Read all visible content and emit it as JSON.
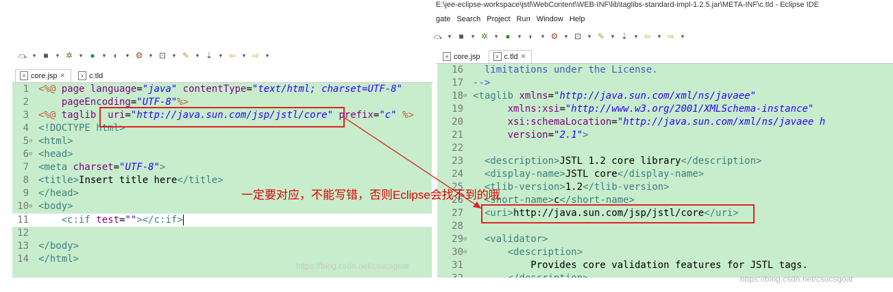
{
  "window": {
    "title_path": "E:\\jee-eclipse-workspace\\jstl\\WebContent\\WEB-INF\\lib\\taglibs-standard-impl-1.2.5.jar\\META-INF\\c.tld - Eclipse IDE",
    "menu": [
      "gate",
      "Search",
      "Project",
      "Run",
      "Window",
      "Help"
    ]
  },
  "left": {
    "tabs": [
      {
        "label": "core.jsp",
        "active": true
      },
      {
        "label": "c.tld",
        "active": false
      }
    ],
    "lines": [
      {
        "n": "1",
        "fold": "",
        "segs": [
          [
            "jsp",
            "<%@ "
          ],
          [
            "attr",
            "page "
          ],
          [
            "attr",
            "language"
          ],
          [
            "text",
            "="
          ],
          [
            "val",
            "\"java\""
          ],
          [
            "text",
            " "
          ],
          [
            "attr",
            "contentType"
          ],
          [
            "text",
            "="
          ],
          [
            "val",
            "\"text/html; charset=UTF-8\""
          ]
        ]
      },
      {
        "n": "2",
        "fold": "",
        "segs": [
          [
            "text",
            "    "
          ],
          [
            "attr",
            "pageEncoding"
          ],
          [
            "text",
            "="
          ],
          [
            "val",
            "\"UTF-8\""
          ],
          [
            "jsp",
            "%>"
          ]
        ]
      },
      {
        "n": "3",
        "fold": "",
        "segs": [
          [
            "jsp",
            "<%@ "
          ],
          [
            "attr",
            "taglib  "
          ],
          [
            "attr",
            "uri"
          ],
          [
            "text",
            "="
          ],
          [
            "val",
            "\"http://java.sun.com/jsp/jstl/core\""
          ],
          [
            "text",
            " "
          ],
          [
            "attr",
            "prefix"
          ],
          [
            "text",
            "="
          ],
          [
            "val",
            "\"c\""
          ],
          [
            "text",
            " "
          ],
          [
            "jsp",
            "%>"
          ]
        ]
      },
      {
        "n": "4",
        "fold": "",
        "segs": [
          [
            "tag",
            "<!DOCTYPE html>"
          ]
        ]
      },
      {
        "n": "5",
        "fold": "⊖",
        "segs": [
          [
            "tag",
            "<html>"
          ]
        ]
      },
      {
        "n": "6",
        "fold": "⊖",
        "segs": [
          [
            "tag",
            "<head>"
          ]
        ]
      },
      {
        "n": "7",
        "fold": "",
        "segs": [
          [
            "tag",
            "<meta "
          ],
          [
            "attr",
            "charset"
          ],
          [
            "text",
            "="
          ],
          [
            "val",
            "\"UTF-8\""
          ],
          [
            "tag",
            ">"
          ]
        ]
      },
      {
        "n": "8",
        "fold": "",
        "segs": [
          [
            "tag",
            "<title>"
          ],
          [
            "text",
            "Insert title here"
          ],
          [
            "tag",
            "</title>"
          ]
        ]
      },
      {
        "n": "9",
        "fold": "",
        "segs": [
          [
            "tag",
            "</head>"
          ]
        ]
      },
      {
        "n": "10",
        "fold": "⊖",
        "segs": [
          [
            "tag",
            "<body>"
          ]
        ]
      },
      {
        "n": "11",
        "fold": "",
        "segs": [
          [
            "text",
            "    "
          ],
          [
            "tag",
            "<c:if "
          ],
          [
            "attr",
            "test"
          ],
          [
            "text",
            "="
          ],
          [
            "val",
            "\"\""
          ],
          [
            "tag",
            "></c:if>"
          ]
        ]
      },
      {
        "n": "12",
        "fold": "",
        "segs": [
          [
            "text",
            ""
          ]
        ]
      },
      {
        "n": "13",
        "fold": "",
        "segs": [
          [
            "tag",
            "</body>"
          ]
        ]
      },
      {
        "n": "14",
        "fold": "",
        "segs": [
          [
            "tag",
            "</html>"
          ]
        ]
      }
    ],
    "watermark": "https://blog.csdn.net/csucsgoat"
  },
  "right": {
    "tabs": [
      {
        "label": "core.jsp",
        "active": false
      },
      {
        "label": "c.tld",
        "active": true
      }
    ],
    "lines": [
      {
        "n": "16",
        "fold": "",
        "segs": [
          [
            "cmt",
            "  limitations under the License."
          ]
        ]
      },
      {
        "n": "17",
        "fold": "",
        "segs": [
          [
            "cmt",
            "-->"
          ]
        ]
      },
      {
        "n": "18",
        "fold": "⊖",
        "segs": [
          [
            "tag",
            "<taglib "
          ],
          [
            "attr",
            "xmlns"
          ],
          [
            "text",
            "="
          ],
          [
            "val",
            "\"http://java.sun.com/xml/ns/javaee\""
          ]
        ]
      },
      {
        "n": "19",
        "fold": "",
        "segs": [
          [
            "text",
            "      "
          ],
          [
            "attr",
            "xmlns:xsi"
          ],
          [
            "text",
            "="
          ],
          [
            "val",
            "\"http://www.w3.org/2001/XMLSchema-instance\""
          ]
        ]
      },
      {
        "n": "20",
        "fold": "",
        "segs": [
          [
            "text",
            "      "
          ],
          [
            "attr",
            "xsi:schemaLocation"
          ],
          [
            "text",
            "="
          ],
          [
            "val",
            "\"http://java.sun.com/xml/ns/javaee h"
          ]
        ]
      },
      {
        "n": "21",
        "fold": "",
        "segs": [
          [
            "text",
            "      "
          ],
          [
            "attr",
            "version"
          ],
          [
            "text",
            "="
          ],
          [
            "val",
            "\"2.1\""
          ],
          [
            "tag",
            ">"
          ]
        ]
      },
      {
        "n": "22",
        "fold": "",
        "segs": [
          [
            "text",
            ""
          ]
        ]
      },
      {
        "n": "23",
        "fold": "",
        "segs": [
          [
            "text",
            "  "
          ],
          [
            "tag",
            "<description>"
          ],
          [
            "text",
            "JSTL 1.2 core library"
          ],
          [
            "tag",
            "</description>"
          ]
        ]
      },
      {
        "n": "24",
        "fold": "",
        "segs": [
          [
            "text",
            "  "
          ],
          [
            "tag",
            "<display-name>"
          ],
          [
            "text",
            "JSTL core"
          ],
          [
            "tag",
            "</display-name>"
          ]
        ]
      },
      {
        "n": "25",
        "fold": "",
        "segs": [
          [
            "text",
            "  "
          ],
          [
            "tag",
            "<tlib-version>"
          ],
          [
            "text",
            "1.2"
          ],
          [
            "tag",
            "</tlib-version>"
          ]
        ]
      },
      {
        "n": "26",
        "fold": "",
        "segs": [
          [
            "text",
            "  "
          ],
          [
            "tag",
            "<short-name>"
          ],
          [
            "text",
            "c"
          ],
          [
            "tag",
            "</short-name>"
          ]
        ]
      },
      {
        "n": "27",
        "fold": "",
        "segs": [
          [
            "text",
            "  "
          ],
          [
            "tag",
            "<uri>"
          ],
          [
            "text",
            "http://java.sun.com/jsp/jstl/core"
          ],
          [
            "tag",
            "</uri>"
          ]
        ]
      },
      {
        "n": "28",
        "fold": "",
        "segs": [
          [
            "text",
            ""
          ]
        ]
      },
      {
        "n": "29",
        "fold": "⊖",
        "segs": [
          [
            "text",
            "  "
          ],
          [
            "tag",
            "<validator>"
          ]
        ]
      },
      {
        "n": "30",
        "fold": "⊖",
        "segs": [
          [
            "text",
            "      "
          ],
          [
            "tag",
            "<description>"
          ]
        ]
      },
      {
        "n": "31",
        "fold": "",
        "segs": [
          [
            "text",
            "          Provides core validation features for JSTL tags."
          ]
        ]
      },
      {
        "n": "32",
        "fold": "",
        "segs": [
          [
            "text",
            "      "
          ],
          [
            "tag",
            "</description>"
          ]
        ]
      }
    ],
    "watermark": "https://blog.csdn.net/csucsgoat"
  },
  "annotation": {
    "text": "一定要对应，不能写错，否则Eclipse会找不到的哦",
    "color": "#e00000"
  },
  "colors": {
    "editor_bg": "#c7edcc",
    "tag": "#3f7f7f",
    "attr": "#7f007f",
    "value": "#2a00ff",
    "jsp": "#bf5f3f",
    "comment": "#3f5fbf",
    "highlight_box": "#e02020"
  },
  "toolbar_icons": [
    "skip-icon",
    "stop-icon",
    "debug-icon",
    "run-icon",
    "coverage-icon",
    "external-tools-icon",
    "open-type-icon",
    "search-icon",
    "next-annotation-icon",
    "back-icon",
    "forward-icon"
  ]
}
